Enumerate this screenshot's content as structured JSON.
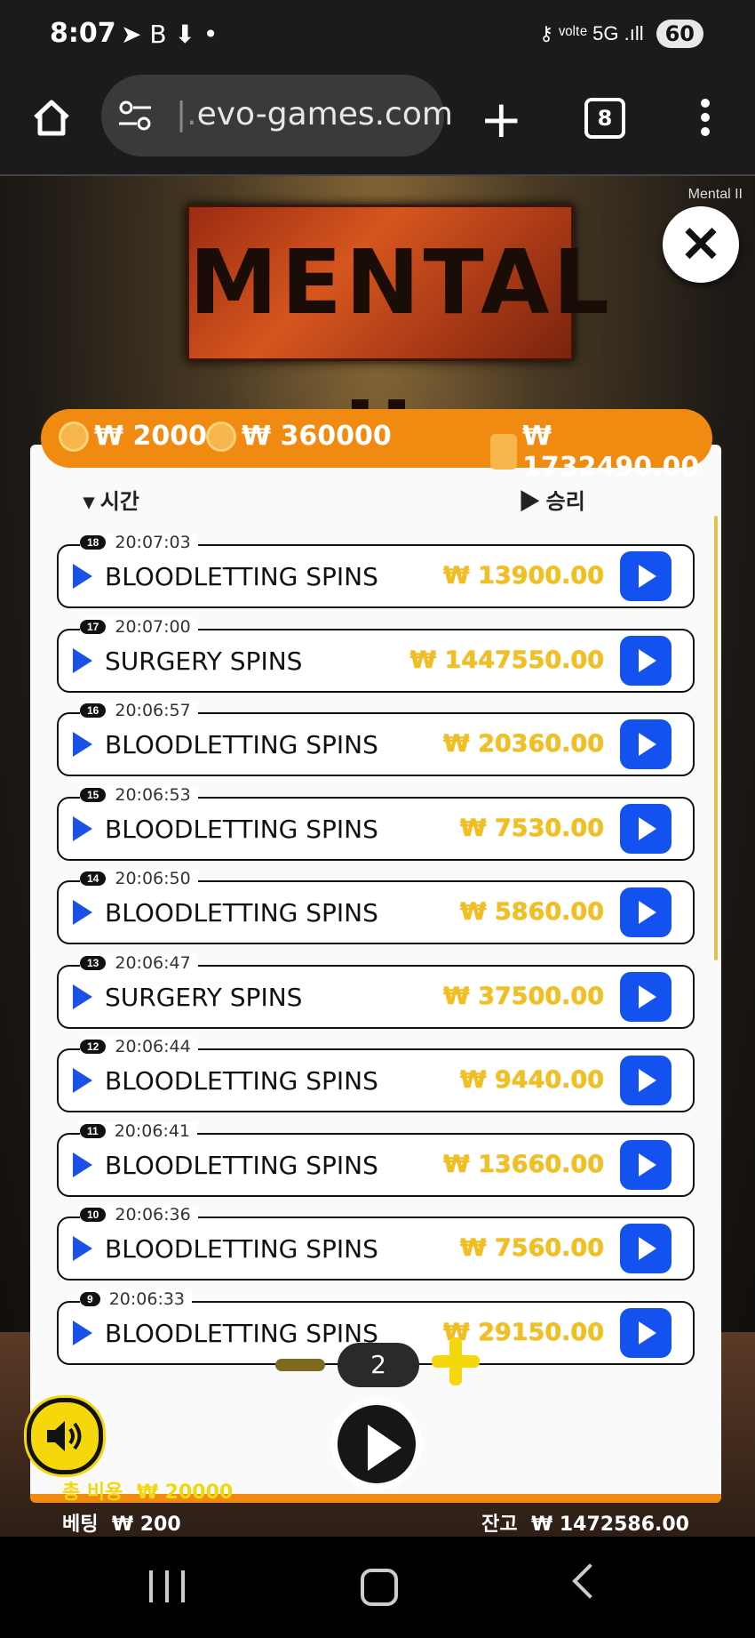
{
  "status_bar": {
    "time": "8:07",
    "left_icons": "➤ B ⬇ •",
    "right_icons": "⚷ ᵛᵒˡᵗᵉ 5G .ıll",
    "battery": "60"
  },
  "browser": {
    "url": "evo-games.com",
    "url_prefix": "|.",
    "tabs_count": "8",
    "plus_symbol": "+"
  },
  "game": {
    "logo_text": "MENTAL II",
    "label": "Mental II",
    "close_symbol": "✕",
    "header": {
      "bet_cost": "₩ 20000",
      "buy_cost": "₩ 360000",
      "win_total": "₩ 1732490.00"
    },
    "columns": {
      "time": "▾ 시간",
      "win": "▶ 승리"
    },
    "rows": [
      {
        "num": "18",
        "time": "20:07:03",
        "name": "BLOODLETTING SPINS",
        "amount": "₩ 13900.00"
      },
      {
        "num": "17",
        "time": "20:07:00",
        "name": "SURGERY SPINS",
        "amount": "₩ 1447550.00"
      },
      {
        "num": "16",
        "time": "20:06:57",
        "name": "BLOODLETTING SPINS",
        "amount": "₩ 20360.00"
      },
      {
        "num": "15",
        "time": "20:06:53",
        "name": "BLOODLETTING SPINS",
        "amount": "₩ 7530.00"
      },
      {
        "num": "14",
        "time": "20:06:50",
        "name": "BLOODLETTING SPINS",
        "amount": "₩ 5860.00"
      },
      {
        "num": "13",
        "time": "20:06:47",
        "name": "SURGERY SPINS",
        "amount": "₩ 37500.00"
      },
      {
        "num": "12",
        "time": "20:06:44",
        "name": "BLOODLETTING SPINS",
        "amount": "₩ 9440.00"
      },
      {
        "num": "11",
        "time": "20:06:41",
        "name": "BLOODLETTING SPINS",
        "amount": "₩ 13660.00"
      },
      {
        "num": "10",
        "time": "20:06:36",
        "name": "BLOODLETTING SPINS",
        "amount": "₩ 7560.00"
      },
      {
        "num": "9",
        "time": "20:06:33",
        "name": "BLOODLETTING SPINS",
        "amount": "₩ 29150.00"
      }
    ],
    "counter_value": "2",
    "footer": {
      "total_cost_label": "총 비용",
      "total_cost_value": "₩ 20000",
      "bet_label": "베팅",
      "bet_value": "₩ 200",
      "balance_label": "잔고",
      "balance_value": "₩ 1472586.00"
    },
    "colors": {
      "accent_orange": "#f08a10",
      "amount_gold": "#f2c01c",
      "play_blue": "#1452f0",
      "control_yellow": "#f4d80b"
    }
  }
}
